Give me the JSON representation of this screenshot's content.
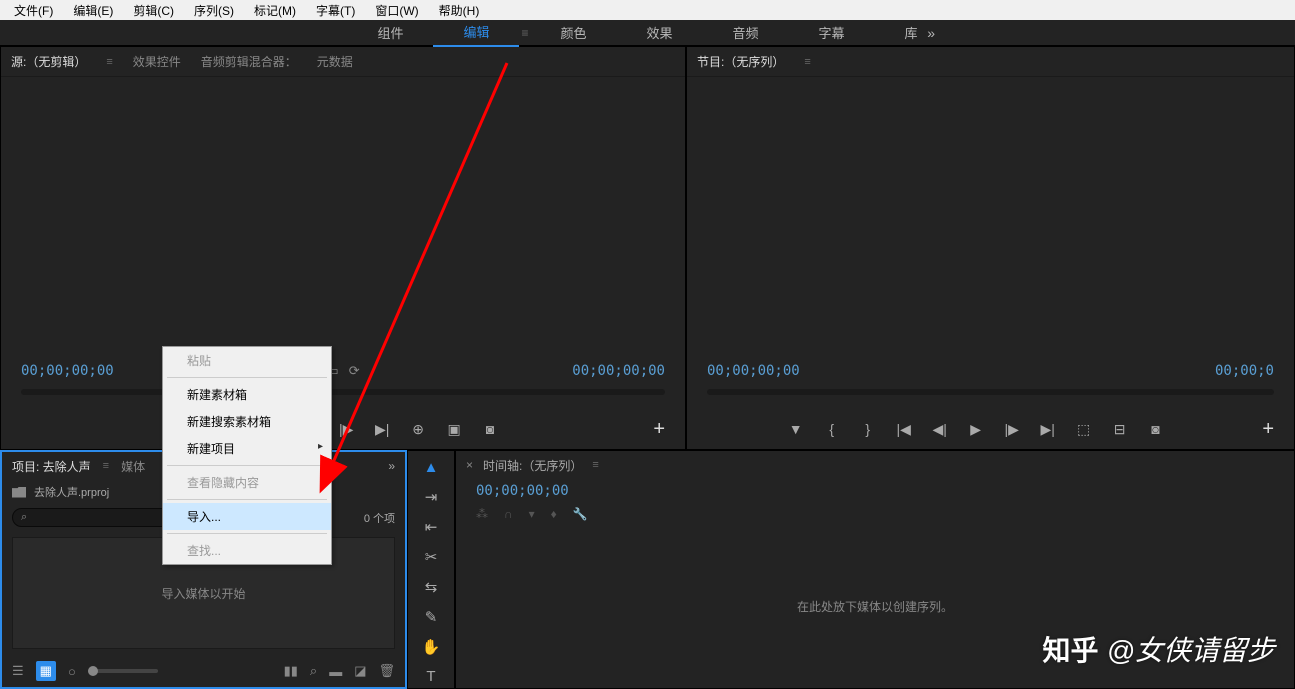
{
  "menubar": [
    "文件(F)",
    "编辑(E)",
    "剪辑(C)",
    "序列(S)",
    "标记(M)",
    "字幕(T)",
    "窗口(W)",
    "帮助(H)"
  ],
  "workspaces": {
    "items": [
      "组件",
      "编辑",
      "颜色",
      "效果",
      "音频",
      "字幕",
      "库"
    ],
    "active": 1
  },
  "source": {
    "tabs": [
      "源:（无剪辑）",
      "效果控件",
      "音频剪辑混合器：",
      "元数据"
    ],
    "active": 0,
    "tc_left": "00;00;00;00",
    "tc_right": "00;00;00;00"
  },
  "program": {
    "title": "节目:（无序列）",
    "tc_left": "00;00;00;00",
    "tc_right": "00;00;0"
  },
  "project": {
    "tabs": [
      "项目: 去除人声",
      "媒体"
    ],
    "file": "去除人声.prproj",
    "count": "0 个项",
    "hint": "导入媒体以开始"
  },
  "timeline": {
    "title": "时间轴:（无序列）",
    "tc": "00;00;00;00",
    "hint": "在此处放下媒体以创建序列。"
  },
  "context": {
    "paste": "粘贴",
    "new_bin": "新建素材箱",
    "new_search_bin": "新建搜索素材箱",
    "new_item": "新建项目",
    "view_hidden": "查看隐藏内容",
    "import": "导入...",
    "find": "查找..."
  },
  "watermark": {
    "logo": "知乎",
    "text": "@女侠请留步"
  }
}
